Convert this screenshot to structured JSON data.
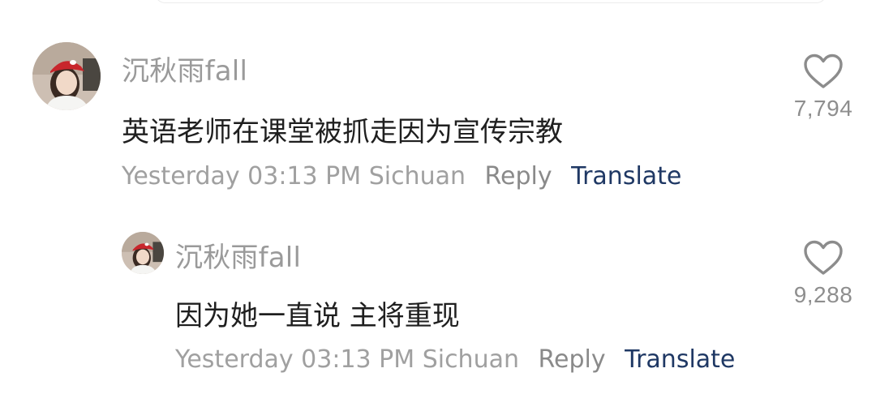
{
  "comments": [
    {
      "username": "沉秋雨fall",
      "text": "英语老师在课堂被抓走因为宣传宗教",
      "time": "Yesterday 03:13 PM",
      "location": "Sichuan",
      "reply_label": "Reply",
      "translate_label": "Translate",
      "likes": "7,794",
      "avatar_icon": "user-avatar-red-cap",
      "like_icon": "heart-outline-icon"
    },
    {
      "username": "沉秋雨fall",
      "text": "因为她一直说 主将重现",
      "time": "Yesterday 03:13 PM",
      "location": "Sichuan",
      "reply_label": "Reply",
      "translate_label": "Translate",
      "likes": "9,288",
      "avatar_icon": "user-avatar-red-cap",
      "like_icon": "heart-outline-icon"
    }
  ],
  "colors": {
    "username": "#9a9a9a",
    "text": "#1f1f1f",
    "meta": "#a0a0a0",
    "translate": "#1f3864",
    "like_count": "#8e8e8e"
  }
}
